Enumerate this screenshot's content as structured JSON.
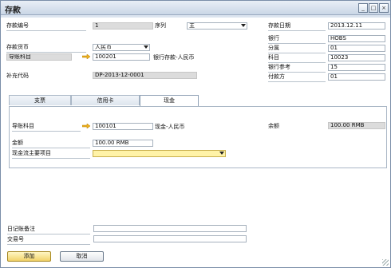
{
  "window": {
    "title": "存款",
    "controls": [
      "minimize-icon",
      "restore-icon",
      "close-icon"
    ]
  },
  "left_header": {
    "deposit_no_label": "存款编号",
    "deposit_no_value": "1",
    "series_label": "序列",
    "series_value": "主",
    "currency_label": "存款货币",
    "currency_value": "人民币",
    "account_label": "导账科目",
    "account_value": "100201",
    "account_desc": "银行存款-人民币",
    "supplement_label": "补充代码",
    "supplement_value": "DP-2013-12-0001"
  },
  "right_header": {
    "date_label": "存款日期",
    "date_value": "2013.12.11",
    "bank_label": "银行",
    "bank_value": "HOBS",
    "branch_label": "分属",
    "branch_value": "01",
    "subject_label": "科目",
    "subject_value": "10023",
    "bank_ref_label": "银行参考",
    "bank_ref_value": "15",
    "payee_label": "付款方",
    "payee_value": "01"
  },
  "tabs": {
    "check": "支票",
    "credit_card": "信用卡",
    "cash": "现金"
  },
  "cash_tab": {
    "account_label": "导账科目",
    "account_value": "100101",
    "account_desc": "现金-人民币",
    "balance_label": "余额",
    "balance_value": "100.00 RMB",
    "amount_label": "金额",
    "amount_value": "100.00 RMB",
    "flow_label": "现金流主要项目",
    "flow_value": ""
  },
  "footer": {
    "journal_remark_label": "日记账备注",
    "journal_remark_value": "",
    "transaction_label": "交易号",
    "transaction_value": ""
  },
  "buttons": {
    "add": "添加",
    "cancel": "取消"
  }
}
